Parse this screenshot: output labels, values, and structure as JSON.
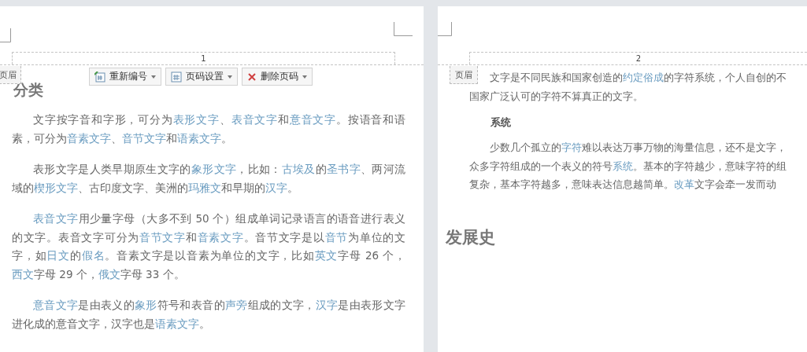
{
  "pages": [
    {
      "number": "1",
      "header_tag": "页眉",
      "toolbar": [
        {
          "label": "重新编号"
        },
        {
          "label": "页码设置"
        },
        {
          "label": "删除页码"
        }
      ],
      "blocks": [
        {
          "kind": "heading",
          "text": "分类"
        },
        {
          "kind": "paragraph",
          "runs": [
            {
              "text": "文字按字音和字形，可分为",
              "link": false
            },
            {
              "text": "表形文字",
              "link": true
            },
            {
              "text": "、",
              "link": false
            },
            {
              "text": "表音文字",
              "link": true
            },
            {
              "text": "和",
              "link": false
            },
            {
              "text": "意音文字",
              "link": true
            },
            {
              "text": "。按语音和语素，可分为",
              "link": false
            },
            {
              "text": "音素文字",
              "link": true
            },
            {
              "text": "、",
              "link": false
            },
            {
              "text": "音节文字",
              "link": true
            },
            {
              "text": "和",
              "link": false
            },
            {
              "text": "语素文字",
              "link": true
            },
            {
              "text": "。",
              "link": false
            }
          ]
        },
        {
          "kind": "paragraph",
          "runs": [
            {
              "text": "表形文字是人类早期原生文字的",
              "link": false
            },
            {
              "text": "象形文字",
              "link": true
            },
            {
              "text": "，比如：",
              "link": false
            },
            {
              "text": "古埃及",
              "link": true
            },
            {
              "text": "的",
              "link": false
            },
            {
              "text": "圣书字",
              "link": true
            },
            {
              "text": "、两河流域的",
              "link": false
            },
            {
              "text": "楔形文字",
              "link": true
            },
            {
              "text": "、古印度文字、美洲的",
              "link": false
            },
            {
              "text": "玛雅文",
              "link": true
            },
            {
              "text": "和早期的",
              "link": false
            },
            {
              "text": "汉字",
              "link": true
            },
            {
              "text": "。",
              "link": false
            }
          ]
        },
        {
          "kind": "paragraph",
          "runs": [
            {
              "text": "表音文字",
              "link": true
            },
            {
              "text": "用少量字母（大多不到 50 个）组成单词记录语言的语音进行表义的文字。表音文字可分为",
              "link": false
            },
            {
              "text": "音节文字",
              "link": true
            },
            {
              "text": "和",
              "link": false
            },
            {
              "text": "音素文字",
              "link": true
            },
            {
              "text": "。音节文字是以",
              "link": false
            },
            {
              "text": "音节",
              "link": true
            },
            {
              "text": "为单位的文字，如",
              "link": false
            },
            {
              "text": "日文",
              "link": true
            },
            {
              "text": "的",
              "link": false
            },
            {
              "text": "假名",
              "link": true
            },
            {
              "text": "。音素文字是以音素为单位的文字，比如",
              "link": false
            },
            {
              "text": "英文",
              "link": true
            },
            {
              "text": "字母 26 个，",
              "link": false
            },
            {
              "text": "西文",
              "link": true
            },
            {
              "text": "字母 29 个，",
              "link": false
            },
            {
              "text": "俄文",
              "link": true
            },
            {
              "text": "字母 33 个。",
              "link": false
            }
          ]
        },
        {
          "kind": "paragraph",
          "runs": [
            {
              "text": "意音文字",
              "link": true
            },
            {
              "text": "是由表义的",
              "link": false
            },
            {
              "text": "象形",
              "link": true
            },
            {
              "text": "符号和表音的",
              "link": false
            },
            {
              "text": "声旁",
              "link": true
            },
            {
              "text": "组成的文字，",
              "link": false
            },
            {
              "text": "汉字",
              "link": true
            },
            {
              "text": "是由表形文字进化成的意音文字，汉字也是",
              "link": false
            },
            {
              "text": "语素文字",
              "link": true
            },
            {
              "text": "。",
              "link": false
            }
          ]
        }
      ]
    },
    {
      "number": "2",
      "header_tag": "页眉",
      "blocks": [
        {
          "kind": "lines",
          "lines": [
            [
              {
                "text": "文字是不同民族和国家创造的",
                "link": false
              },
              {
                "text": "约定俗成",
                "link": true
              },
              {
                "text": "的字符系统，个人自创的不",
                "link": false
              }
            ],
            [
              {
                "text": "国家广泛认可的字符不算真正的文字。",
                "link": false
              }
            ]
          ]
        },
        {
          "kind": "subheading",
          "text": "系统"
        },
        {
          "kind": "lines",
          "lines": [
            [
              {
                "text": "少数几个孤立的",
                "link": false
              },
              {
                "text": "字符",
                "link": true
              },
              {
                "text": "难以表达万事万物的海量信息，还不是文字，",
                "link": false
              }
            ],
            [
              {
                "text": "众多字符组成的一个表义的符号",
                "link": false
              },
              {
                "text": "系统",
                "link": true
              },
              {
                "text": "。基本的字符越少，意味字符的组",
                "link": false
              }
            ],
            [
              {
                "text": "复杂，基本字符越多，意味表达信息越简单。",
                "link": false
              },
              {
                "text": "改革",
                "link": true
              },
              {
                "text": "文字会牵一发而动",
                "link": false
              }
            ]
          ]
        },
        {
          "kind": "heading",
          "text": "发展史"
        }
      ]
    }
  ]
}
